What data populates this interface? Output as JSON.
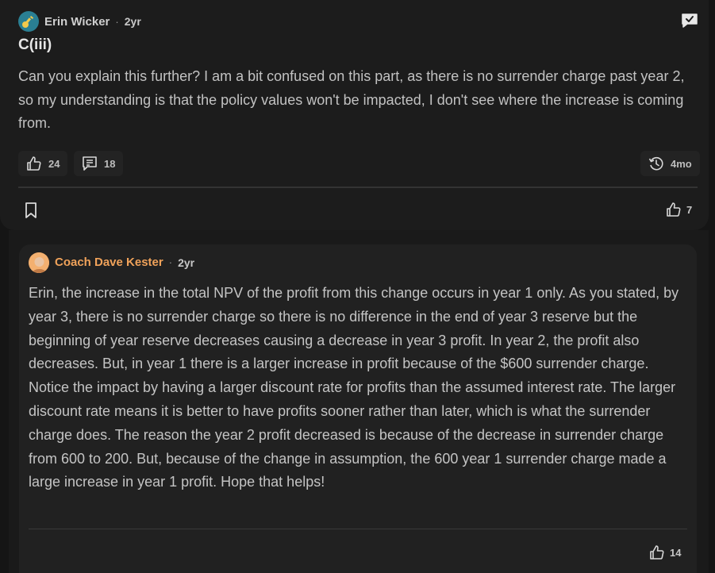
{
  "post": {
    "author": "Erin Wicker",
    "separator": "·",
    "time": "2yr",
    "title": "C(iii)",
    "body": "Can you explain this further? I am a bit confused on this part, as there is no surrender charge past year 2, so my understanding is that the policy values won't be impacted, I don't see where the increase is coming from.",
    "likes": "24",
    "comments": "18",
    "history": "4mo",
    "footer_likes": "7",
    "icons": {
      "avatar": "key-avatar-icon",
      "chat": "chat-check-icon",
      "like": "thumbs-up-icon",
      "comment": "comment-icon",
      "history": "history-icon",
      "bookmark": "bookmark-icon"
    }
  },
  "reply": {
    "author": "Coach Dave Kester",
    "separator": "·",
    "time": "2yr",
    "body": "Erin, the increase in the total NPV of the profit from this change occurs in year 1 only. As you stated, by year 3, there is no surrender charge so there is no difference in the end of year 3 reserve but the beginning of year reserve decreases causing a decrease in year 3 profit. In year 2, the profit also decreases. But, in year 1 there is a larger increase in profit because of the $600 surrender charge. Notice the impact by having a larger discount rate for profits than the assumed interest rate. The larger discount rate means it is better to have profits sooner rather than later, which is what the surrender charge does. The reason the year 2 profit decreased is because of the decrease in surrender charge from 600 to 200. But, because of the change in assumption, the 600 year 1 surrender charge made a large increase in year 1 profit. Hope that helps!",
    "likes": "14",
    "author_color": "#f0a25a"
  }
}
